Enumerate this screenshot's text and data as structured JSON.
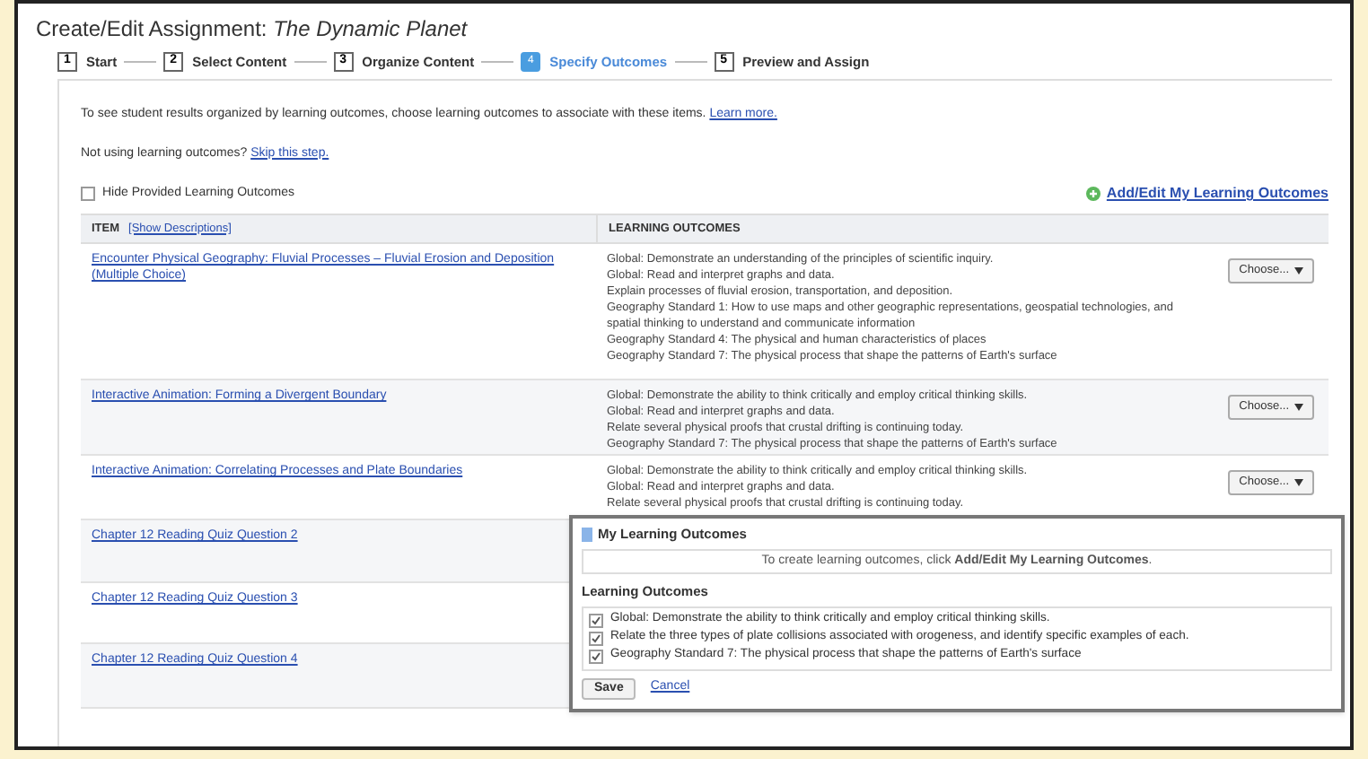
{
  "title": "Create/Edit Assignment: *The Dynamic Planet*",
  "steps": [
    {
      "number": "1",
      "label": "Start",
      "selected": false
    },
    {
      "number": "2",
      "label": "Select Content",
      "selected": false
    },
    {
      "number": "3",
      "label": "Organize Content",
      "selected": false
    },
    {
      "number": "4",
      "label": "Specify Outcomes",
      "selected": true
    },
    {
      "number": "5",
      "label": "Preview and Assign",
      "selected": false
    }
  ],
  "intro": {
    "text": "To see student results organized by learning outcomes, choose learning outcomes to associate with these items.",
    "link": "Learn more."
  },
  "skip": {
    "text": "Not using learning outcomes?",
    "link": "Skip this step."
  },
  "hide_provided": {
    "label": "Hide Provided Learning Outcomes",
    "checked": false
  },
  "add_edit_link": "Add/Edit My Learning Outcomes",
  "table": {
    "columns": [
      {
        "label": "ITEM",
        "link": "[Show Descriptions]"
      },
      {
        "label": "LEARNING OUTCOMES"
      }
    ],
    "rows": [
      {
        "item": "Encounter Physical Geography: Fluvial Processes – Fluvial Erosion and Deposition (Multiple Choice)",
        "outcomes": [
          "Global: Demonstrate an understanding of the principles of scientific inquiry.",
          "Global: Read and interpret graphs and data.",
          "Explain processes of fluvial erosion, transportation, and deposition.",
          "Geography Standard 1: How to use maps and other geographic representations, geospatial technologies, and spatial thinking to understand and communicate information",
          "Geography Standard 4: The physical and human characteristics of places",
          "Geography Standard 7: The physical process that shape the patterns of Earth's surface"
        ],
        "button": "Choose..."
      },
      {
        "item": "Interactive Animation: Forming a Divergent Boundary",
        "outcomes": [
          "Global: Demonstrate the ability to think critically and employ critical thinking skills.",
          "Global: Read and interpret graphs and data.",
          "Relate several physical proofs that crustal drifting is continuing today.",
          "Geography Standard 7: The physical process that shape the patterns of Earth's surface"
        ],
        "button": "Choose..."
      },
      {
        "item": "Interactive Animation: Correlating Processes and Plate Boundaries",
        "outcomes": [
          "Global: Demonstrate the ability to think critically and employ critical thinking skills.",
          "Global: Read and interpret graphs and data.",
          "Relate several physical proofs that crustal drifting is continuing today."
        ],
        "button": "Choose..."
      },
      {
        "item": "Chapter 12 Reading Quiz Question 2"
      },
      {
        "item": "Chapter 12 Reading Quiz Question 3"
      },
      {
        "item": "Chapter 12 Reading Quiz Question 4"
      }
    ]
  },
  "popup": {
    "title": "My Learning Outcomes",
    "hint": "To create learning outcomes, click **Add/Edit My Learning Outcomes**.",
    "section": "Learning Outcomes",
    "items": [
      {
        "label": "Global: Demonstrate the ability to think critically and employ critical thinking skills.",
        "checked": true
      },
      {
        "label": "Relate the three types of plate collisions associated with orogeness, and identify specific examples of each.",
        "checked": true
      },
      {
        "label": "Geography Standard 7: The physical process that shape the patterns of Earth's surface",
        "checked": true
      }
    ],
    "save": "Save",
    "cancel": "Cancel"
  }
}
